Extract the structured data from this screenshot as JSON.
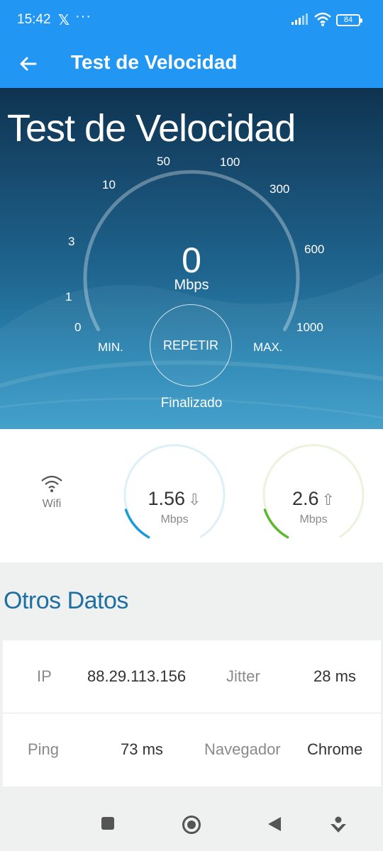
{
  "status_bar": {
    "time": "15:42",
    "x_glyph": "𝕏",
    "more_glyph": "···",
    "battery": "84"
  },
  "app_bar": {
    "title": "Test de Velocidad"
  },
  "hero": {
    "title": "Test de Velocidad",
    "ticks": {
      "t0": "0",
      "t1": "1",
      "t3": "3",
      "t10": "10",
      "t50": "50",
      "t100": "100",
      "t300": "300",
      "t600": "600",
      "t1000": "1000"
    },
    "min_label": "MIN.",
    "max_label": "MAX.",
    "speed_value": "0",
    "speed_unit": "Mbps",
    "repeat_label": "REPETIR",
    "status": "Finalizado"
  },
  "results": {
    "connection_label": "Wifi",
    "download": {
      "value": "1.56",
      "unit": "Mbps",
      "arrow": "⇩",
      "color": "#1a9bd7"
    },
    "upload": {
      "value": "2.6",
      "unit": "Mbps",
      "arrow": "⇧",
      "color": "#5cb82e"
    }
  },
  "other_data": {
    "title": "Otros Datos",
    "ip_label": "IP",
    "ip_value": "88.29.113.156",
    "jitter_label": "Jitter",
    "jitter_value": "28 ms",
    "ping_label": "Ping",
    "ping_value": "73 ms",
    "browser_label": "Navegador",
    "browser_value": "Chrome"
  },
  "colors": {
    "primary": "#2196f3",
    "section_title": "#1f6fa3"
  }
}
